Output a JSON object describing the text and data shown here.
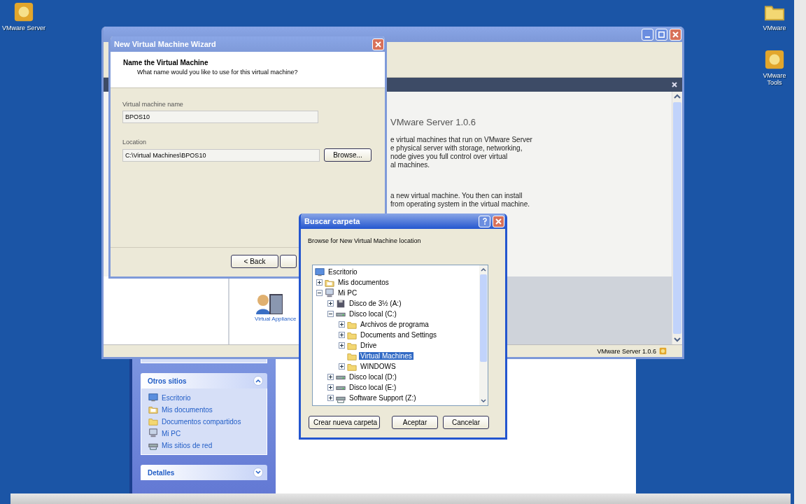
{
  "desktop_icons_left": [
    {
      "label": "VMware Server",
      "kind": "app"
    }
  ],
  "desktop_icons_right": [
    {
      "label": "VMware",
      "kind": "folder"
    },
    {
      "label": "VMware Tools",
      "kind": "app"
    }
  ],
  "main_window": {
    "heading": "VMware Server 1.0.6",
    "paragraphs": [
      "e virtual machines that run on VMware Server\ne physical server with storage, networking,\nnode gives you full control over virtual\nal machines.",
      "a new virtual machine. You then can install\nfrom operating system in the virtual machine."
    ],
    "appliance_label": "Virtual Appliance",
    "status": "VMware Server 1.0.6"
  },
  "wizard": {
    "title": "New Virtual Machine Wizard",
    "heading": "Name the Virtual Machine",
    "subheading": "What name would you like to use for this virtual machine?",
    "fields": [
      {
        "label": "Virtual machine name",
        "value": "BPOS10",
        "kind": "text"
      },
      {
        "label": "Location",
        "value": "C:\\Virtual Machines\\BPOS10",
        "kind": "path"
      }
    ],
    "browse_button": "Browse...",
    "back_button": "< Back"
  },
  "browse_dialog": {
    "title": "Buscar carpeta",
    "prompt": "Browse for New Virtual Machine location",
    "tree": [
      {
        "label": "Escritorio",
        "kind": "desktop",
        "selected": false,
        "children": [
          {
            "label": "Mis documentos",
            "kind": "documents",
            "expanded": false,
            "selected": false
          },
          {
            "label": "Mi PC",
            "kind": "computer",
            "expanded": true,
            "selected": false,
            "children": [
              {
                "label": "Disco de 3½ (A:)",
                "kind": "floppy",
                "expanded": false,
                "selected": false
              },
              {
                "label": "Disco local (C:)",
                "kind": "drive",
                "expanded": true,
                "selected": false,
                "children": [
                  {
                    "label": "Archivos de programa",
                    "kind": "folder",
                    "expanded": false,
                    "selected": false
                  },
                  {
                    "label": "Documents and Settings",
                    "kind": "folder",
                    "expanded": false,
                    "selected": false
                  },
                  {
                    "label": "Drive",
                    "kind": "folder",
                    "expanded": false,
                    "selected": false
                  },
                  {
                    "label": "Virtual Machines",
                    "kind": "folder",
                    "selected": true
                  },
                  {
                    "label": "WINDOWS",
                    "kind": "folder",
                    "expanded": false,
                    "selected": false
                  }
                ]
              },
              {
                "label": "Disco local (D:)",
                "kind": "drive",
                "expanded": false,
                "selected": false
              },
              {
                "label": "Disco local (E:)",
                "kind": "drive",
                "expanded": false,
                "selected": false
              },
              {
                "label": "Software Support (Z:)",
                "kind": "network",
                "expanded": false,
                "selected": false
              }
            ]
          }
        ]
      }
    ],
    "buttons": [
      "Crear nueva carpeta",
      "Aceptar",
      "Cancelar"
    ]
  },
  "explorer": {
    "panels": [
      {
        "title": "Otros sitios",
        "expanded": true,
        "items": [
          {
            "label": "Escritorio",
            "kind": "desktop"
          },
          {
            "label": "Mis documentos",
            "kind": "documents"
          },
          {
            "label": "Documentos compartidos",
            "kind": "folder"
          },
          {
            "label": "Mi PC",
            "kind": "computer"
          },
          {
            "label": "Mis sitios de red",
            "kind": "network"
          }
        ]
      },
      {
        "title": "Detalles",
        "expanded": false
      }
    ]
  }
}
